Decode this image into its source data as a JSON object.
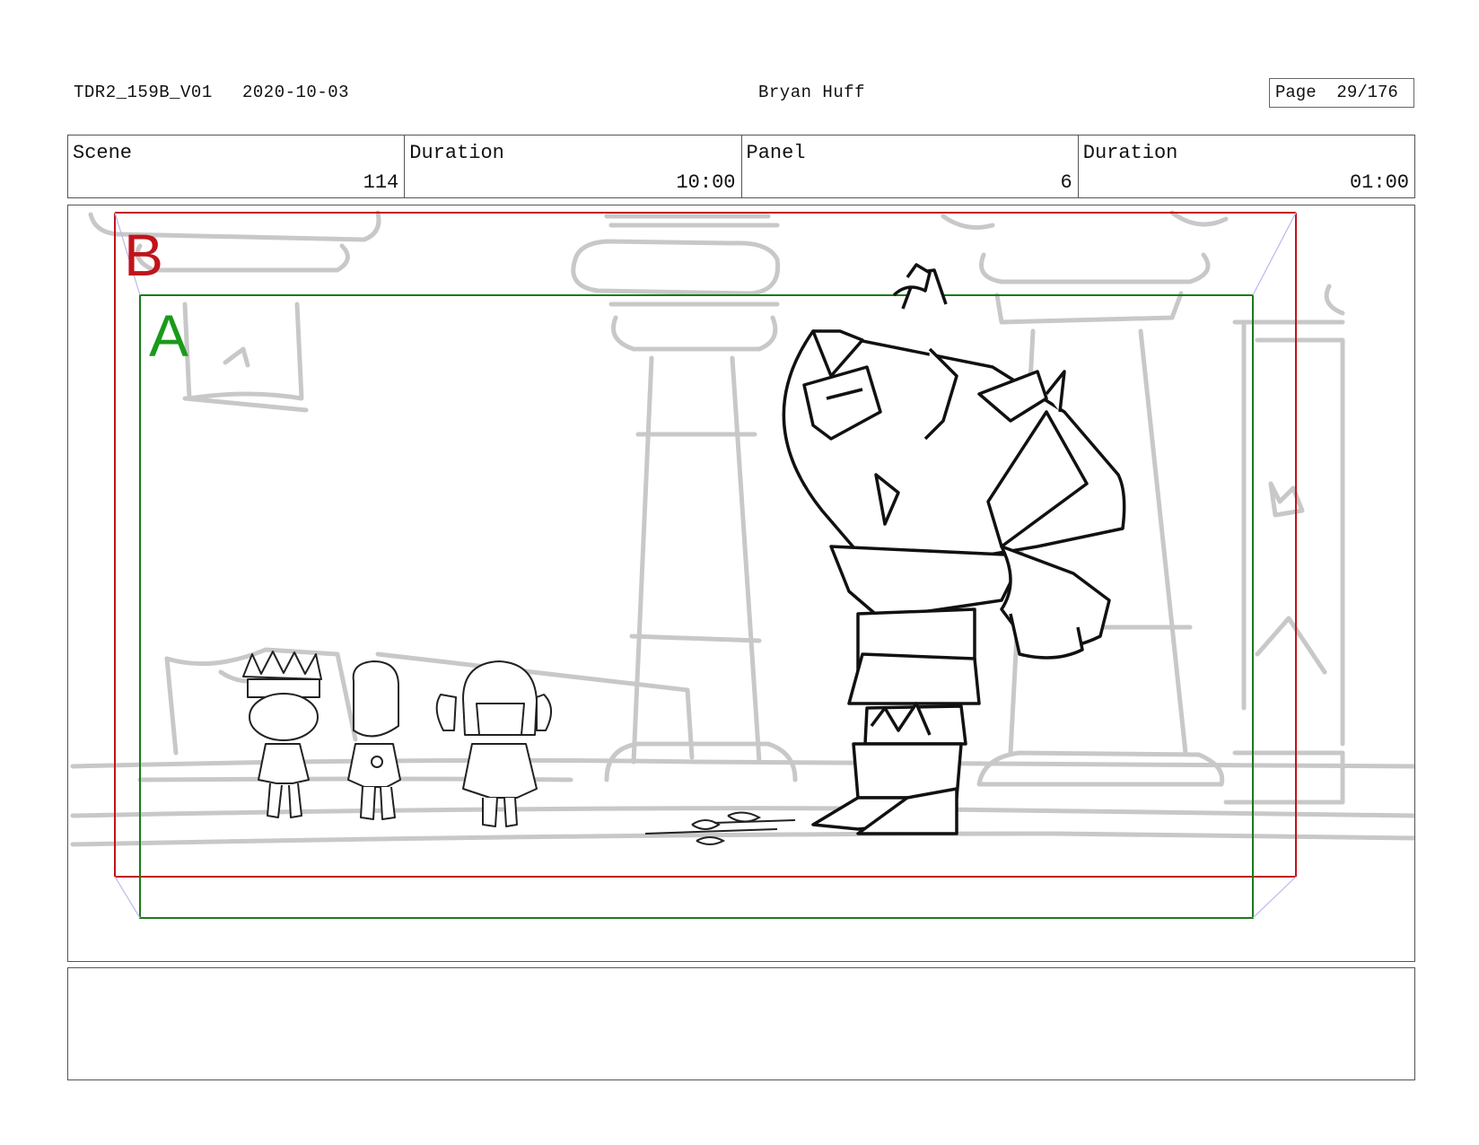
{
  "header": {
    "file_id": "TDR2_159B_V01",
    "date": "2020-10-03",
    "artist": "Bryan Huff",
    "page_label": "Page",
    "page_value": "29/176"
  },
  "info": {
    "scene_label": "Scene",
    "scene_value": "114",
    "scene_duration_label": "Duration",
    "scene_duration_value": "10:00",
    "panel_label": "Panel",
    "panel_value": "6",
    "panel_duration_label": "Duration",
    "panel_duration_value": "01:00"
  },
  "frames": {
    "outer_label": "B",
    "inner_label": "A",
    "outer_color": "#c0141c",
    "inner_color": "#1a9a1a"
  },
  "notes": {
    "text": ""
  }
}
